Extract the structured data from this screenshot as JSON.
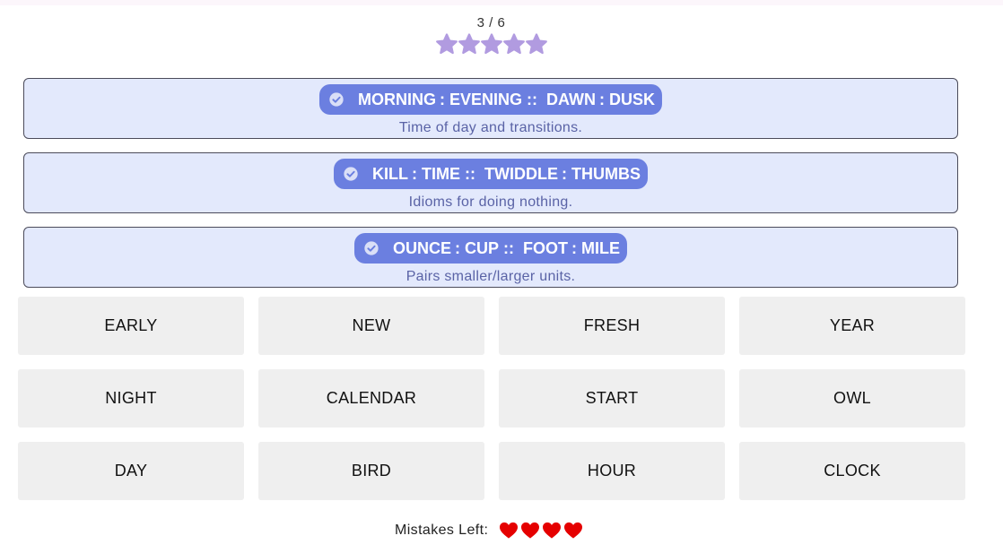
{
  "progress": {
    "text": "3 / 6"
  },
  "stars": {
    "count": 5,
    "color": "#b19be0",
    "icon": "star-icon"
  },
  "solved_groups": [
    {
      "words": [
        "MORNING",
        "EVENING",
        "DAWN",
        "DUSK"
      ],
      "sep1": ":",
      "sep2": "::",
      "sep3": ":",
      "description": "Time of day and transitions."
    },
    {
      "words": [
        "KILL",
        "TIME",
        "TWIDDLE",
        "THUMBS"
      ],
      "sep1": ":",
      "sep2": "::",
      "sep3": ":",
      "description": "Idioms for doing nothing."
    },
    {
      "words": [
        "OUNCE",
        "CUP",
        "FOOT",
        "MILE"
      ],
      "sep1": ":",
      "sep2": "::",
      "sep3": ":",
      "description": "Pairs smaller/larger units."
    }
  ],
  "tiles": [
    [
      "EARLY",
      "NEW",
      "FRESH",
      "YEAR"
    ],
    [
      "NIGHT",
      "CALENDAR",
      "START",
      "OWL"
    ],
    [
      "DAY",
      "BIRD",
      "HOUR",
      "CLOCK"
    ]
  ],
  "mistakes": {
    "label": "Mistakes Left:",
    "remaining": 4,
    "icon": "heart-icon",
    "color": "#e50000"
  },
  "colors": {
    "solved_bg": "#e3e9fc",
    "pill_bg": "#6b7fe0",
    "description_text": "#5a63a6",
    "tile_bg": "#efefef"
  }
}
